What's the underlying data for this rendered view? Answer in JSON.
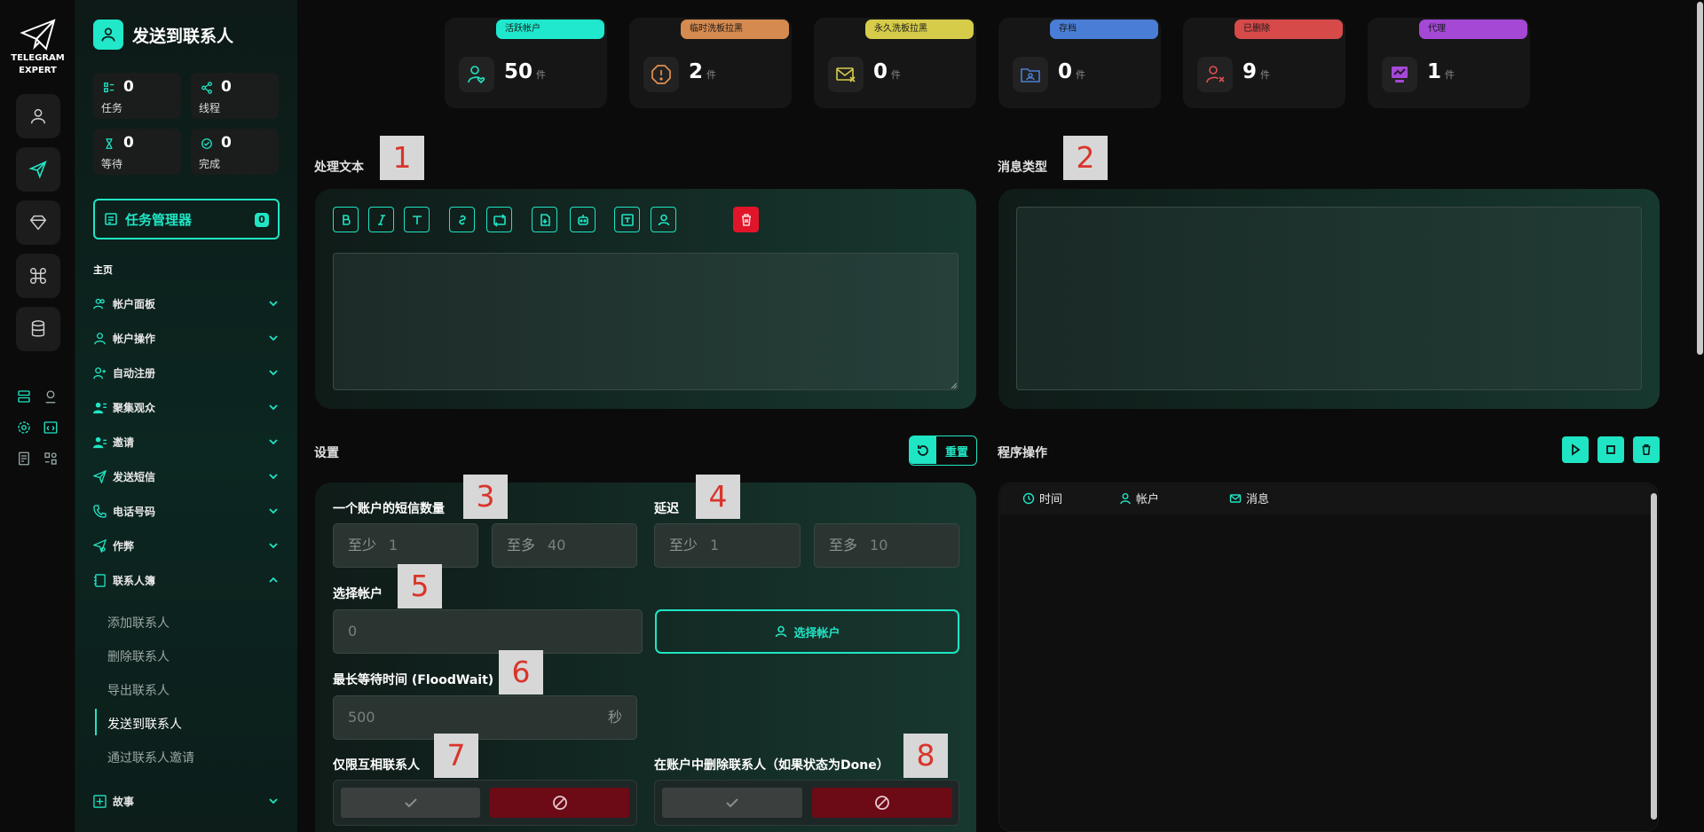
{
  "app": {
    "logo_line1": "TELEGRAM",
    "logo_line2": "EXPERT"
  },
  "sidebar": {
    "title": "发送到联系人",
    "stats": [
      {
        "value": "0",
        "label": "任务"
      },
      {
        "value": "0",
        "label": "线程"
      },
      {
        "value": "0",
        "label": "等待"
      },
      {
        "value": "0",
        "label": "完成"
      }
    ],
    "task_manager": {
      "label": "任务管理器",
      "count": "0"
    },
    "home_label": "主页",
    "nav": [
      {
        "label": "帐户面板"
      },
      {
        "label": "帐户操作"
      },
      {
        "label": "自动注册"
      },
      {
        "label": "聚集观众"
      },
      {
        "label": "邀请"
      },
      {
        "label": "发送短信"
      },
      {
        "label": "电话号码"
      },
      {
        "label": "作弊"
      },
      {
        "label": "联系人簿"
      }
    ],
    "sub_items": [
      {
        "label": "添加联系人"
      },
      {
        "label": "删除联系人"
      },
      {
        "label": "导出联系人"
      },
      {
        "label": "发送到联系人"
      },
      {
        "label": "通过联系人邀请"
      }
    ],
    "story": {
      "label": "故事"
    }
  },
  "top_stats": [
    {
      "pill": "活跃帐户",
      "value": "50",
      "unit": "件",
      "pill_color": "#1fe8cf",
      "icon_color": "#1fe5c4"
    },
    {
      "pill": "临时洗板拉黑",
      "value": "2",
      "unit": "件",
      "pill_color": "#d58a4f",
      "icon_color": "#e09050"
    },
    {
      "pill": "永久洗板拉黑",
      "value": "0",
      "unit": "件",
      "pill_color": "#d6cc4a",
      "icon_color": "#d6cc4a"
    },
    {
      "pill": "存档",
      "value": "0",
      "unit": "件",
      "pill_color": "#4a7ed6",
      "icon_color": "#4a7ed6"
    },
    {
      "pill": "已删除",
      "value": "9",
      "unit": "件",
      "pill_color": "#d64a4a",
      "icon_color": "#e05050"
    },
    {
      "pill": "代理",
      "value": "1",
      "unit": "件",
      "pill_color": "#a548d6",
      "icon_color": "#a548d6"
    }
  ],
  "text_section": {
    "label": "处理文本",
    "tag": "1"
  },
  "msg_type_section": {
    "label": "消息类型",
    "tag": "2"
  },
  "settings": {
    "label": "设置",
    "reset_label": "重置",
    "sms_per_account": {
      "label": "一个账户的短信数量",
      "tag": "3",
      "min_prefix": "至少",
      "min": "1",
      "max_prefix": "至多",
      "max": "40"
    },
    "delay": {
      "label": "延迟",
      "tag": "4",
      "min_prefix": "至少",
      "min": "1",
      "max_prefix": "至多",
      "max": "10"
    },
    "select_account": {
      "label": "选择帐户",
      "tag": "5",
      "value": "0",
      "button": "选择帐户"
    },
    "flood_wait": {
      "label": "最长等待时间 (FloodWait)",
      "tag": "6",
      "value": "500",
      "unit": "秒"
    },
    "mutual_only": {
      "label": "仅限互相联系人",
      "tag": "7"
    },
    "delete_contacts": {
      "label": "在账户中删除联系人（如果状态为Done）",
      "tag": "8"
    }
  },
  "program": {
    "label": "程序操作",
    "columns": [
      {
        "label": "时间"
      },
      {
        "label": "帐户"
      },
      {
        "label": "消息"
      }
    ]
  },
  "colors": {
    "accent": "#1fe5c4",
    "danger": "#e0152a",
    "bg": "#0b0b0b"
  }
}
